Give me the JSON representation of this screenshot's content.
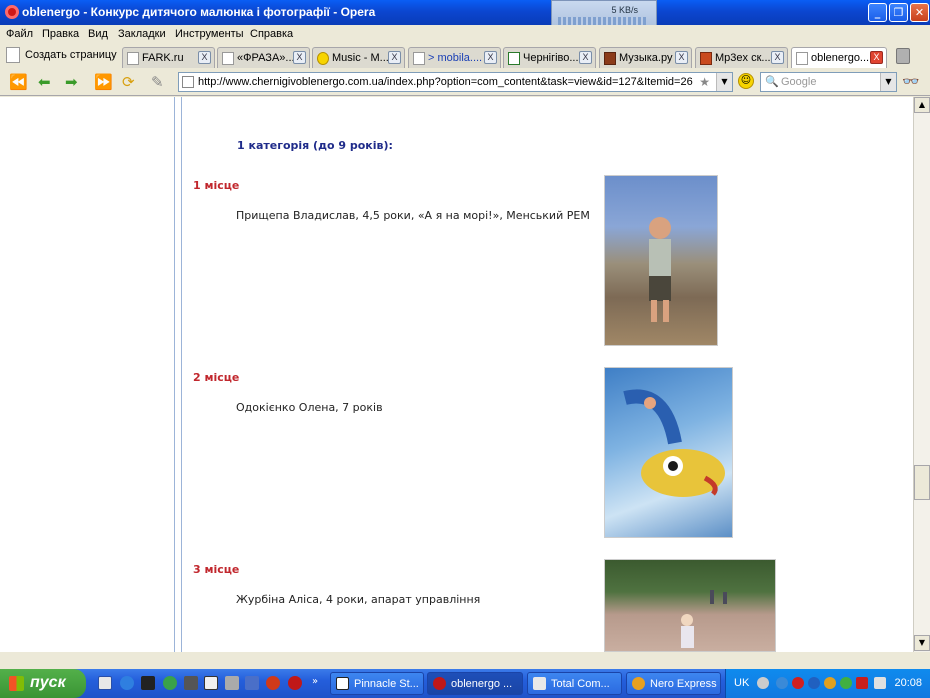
{
  "window": {
    "title": "oblenergo - Конкурс дитячого малюнка і фотографії - Opera",
    "speed": "5 KB/s"
  },
  "menu": [
    "Файл",
    "Правка",
    "Вид",
    "Закладки",
    "Инструменты",
    "Справка"
  ],
  "tabs": {
    "create_page": "Создать страницу",
    "items": [
      {
        "label": "FARK.ru"
      },
      {
        "label": "«ФРАЗА»..."
      },
      {
        "label": "Music - M..."
      },
      {
        "label": "> mobila...."
      },
      {
        "label": "Чернігіво..."
      },
      {
        "label": "Музыка.ру"
      },
      {
        "label": "Mp3ex ск..."
      },
      {
        "label": "oblenergo..."
      }
    ],
    "close_glyph": "X"
  },
  "address": {
    "url": "http://www.chernigivoblenergo.com.ua/index.php?option=com_content&task=view&id=127&Itemid=26",
    "search_placeholder": "Google"
  },
  "content": {
    "category": "1 категорія (до 9 років):",
    "entries": [
      {
        "place": "1 місце",
        "desc": "Прищепа Владислав, 4,5 роки, «А я на морі!», Менський РЕМ"
      },
      {
        "place": "2 місце",
        "desc": "Одокієнко Олена, 7 років"
      },
      {
        "place": "3 місце",
        "desc": "Журбіна Аліса, 4 роки, апарат управління"
      }
    ]
  },
  "taskbar": {
    "start": "пуск",
    "items": [
      {
        "label": "Pinnacle St..."
      },
      {
        "label": "oblenergo ..."
      },
      {
        "label": "Total Com..."
      },
      {
        "label": "Nero Express"
      }
    ],
    "lang": "UK",
    "clock": "20:08"
  },
  "colors": {
    "category": "#1f2b8a",
    "place": "#c1272d",
    "titlebar": "#0b46d0"
  }
}
